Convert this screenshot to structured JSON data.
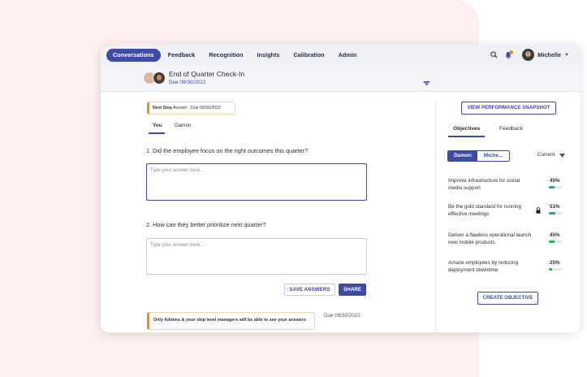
{
  "nav": {
    "tabs": [
      {
        "label": "Conversations"
      },
      {
        "label": "Feedback"
      },
      {
        "label": "Recognition"
      },
      {
        "label": "Insights"
      },
      {
        "label": "Calibration"
      },
      {
        "label": "Admin"
      }
    ],
    "active_tab": "Conversations",
    "user_name": "Michelle",
    "icons": [
      "search-icon",
      "bell-icon",
      "chevron-down-icon"
    ],
    "accent_color": "#3d4aa8",
    "notification_color": "#f28a1a"
  },
  "header": {
    "title": "End of Quarter Check-In",
    "due": "Due 09/30/2022"
  },
  "main": {
    "next_step_label": "Next Step",
    "next_step_rest": " Answer · Due 09/30/2022",
    "subtabs": [
      {
        "label": "You"
      },
      {
        "label": "Damon"
      }
    ],
    "questions": [
      {
        "text": "1. Did the employee focus on the right outcomes this quarter?",
        "placeholder": "Type your answer here..."
      },
      {
        "text": "2. How can they better prioritize next quarter?",
        "placeholder": "Type your answer here..."
      }
    ],
    "save_label": "SAVE ANSWERS",
    "share_label": "SHARE",
    "note": "Only Admins & your skip level managers will be able to see your answers",
    "note_due": "Due 09/30/2022"
  },
  "sidebar": {
    "snapshot_label": "VIEW PERFORMANCE SNAPSHOT",
    "tabs": [
      {
        "label": "Objectives"
      },
      {
        "label": "Feedback"
      }
    ],
    "segment": [
      {
        "label": "Damon"
      },
      {
        "label": "Miche..."
      }
    ],
    "filter": "Current",
    "objectives": [
      {
        "text": "Improve infrastructure for social media support",
        "pct": "45%",
        "value": 0.45,
        "locked": false
      },
      {
        "text": "Be the gold standard for running effective meetings",
        "pct": "51%",
        "value": 0.51,
        "locked": true
      },
      {
        "text": "Deliver a flawless operational launch new mobile products",
        "pct": "45%",
        "value": 0.45,
        "locked": false
      },
      {
        "text": "Amaze employees by reducing deployment downtime",
        "pct": "25%",
        "value": 0.25,
        "locked": false
      }
    ],
    "progress_color": "#2fb35a",
    "create_label": "CREATE OBJECTIVE"
  }
}
